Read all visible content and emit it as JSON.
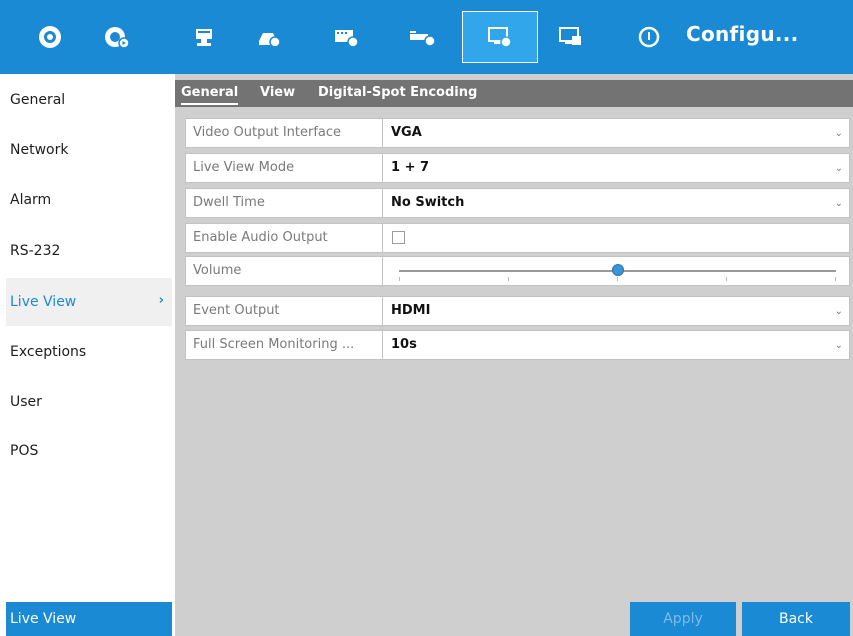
{
  "toolbar": {
    "title": "Configu...",
    "icons": [
      "live-view-icon",
      "playback-icon",
      "camera-icon",
      "record-icon",
      "hdd-icon",
      "network-icon",
      "display-settings-icon",
      "system-icon",
      "config-icon"
    ],
    "active_index": 6
  },
  "sidebar": {
    "items": [
      {
        "label": "General"
      },
      {
        "label": "Network"
      },
      {
        "label": "Alarm"
      },
      {
        "label": "RS-232"
      },
      {
        "label": "Live View",
        "selected": true
      },
      {
        "label": "Exceptions"
      },
      {
        "label": "User"
      },
      {
        "label": "POS"
      }
    ],
    "footer": "Live View"
  },
  "tabs": [
    {
      "label": "General",
      "active": true
    },
    {
      "label": "View"
    },
    {
      "label": "Digital-Spot Encoding"
    }
  ],
  "settings": {
    "video_output_interface": {
      "label": "Video Output Interface",
      "value": "VGA"
    },
    "live_view_mode": {
      "label": "Live View Mode",
      "value": "1 + 7"
    },
    "dwell_time": {
      "label": "Dwell Time",
      "value": "No Switch"
    },
    "enable_audio_output": {
      "label": "Enable Audio Output",
      "checked": false
    },
    "volume": {
      "label": "Volume",
      "level": 0.5
    },
    "event_output": {
      "label": "Event Output",
      "value": "HDMI"
    },
    "full_screen_monitoring": {
      "label": "Full Screen Monitoring ...",
      "value": "10s"
    }
  },
  "buttons": {
    "apply": "Apply",
    "back": "Back"
  },
  "colors": {
    "accent": "#1a8ad4",
    "panel": "#cfcfcf",
    "tabbar": "#737373"
  }
}
